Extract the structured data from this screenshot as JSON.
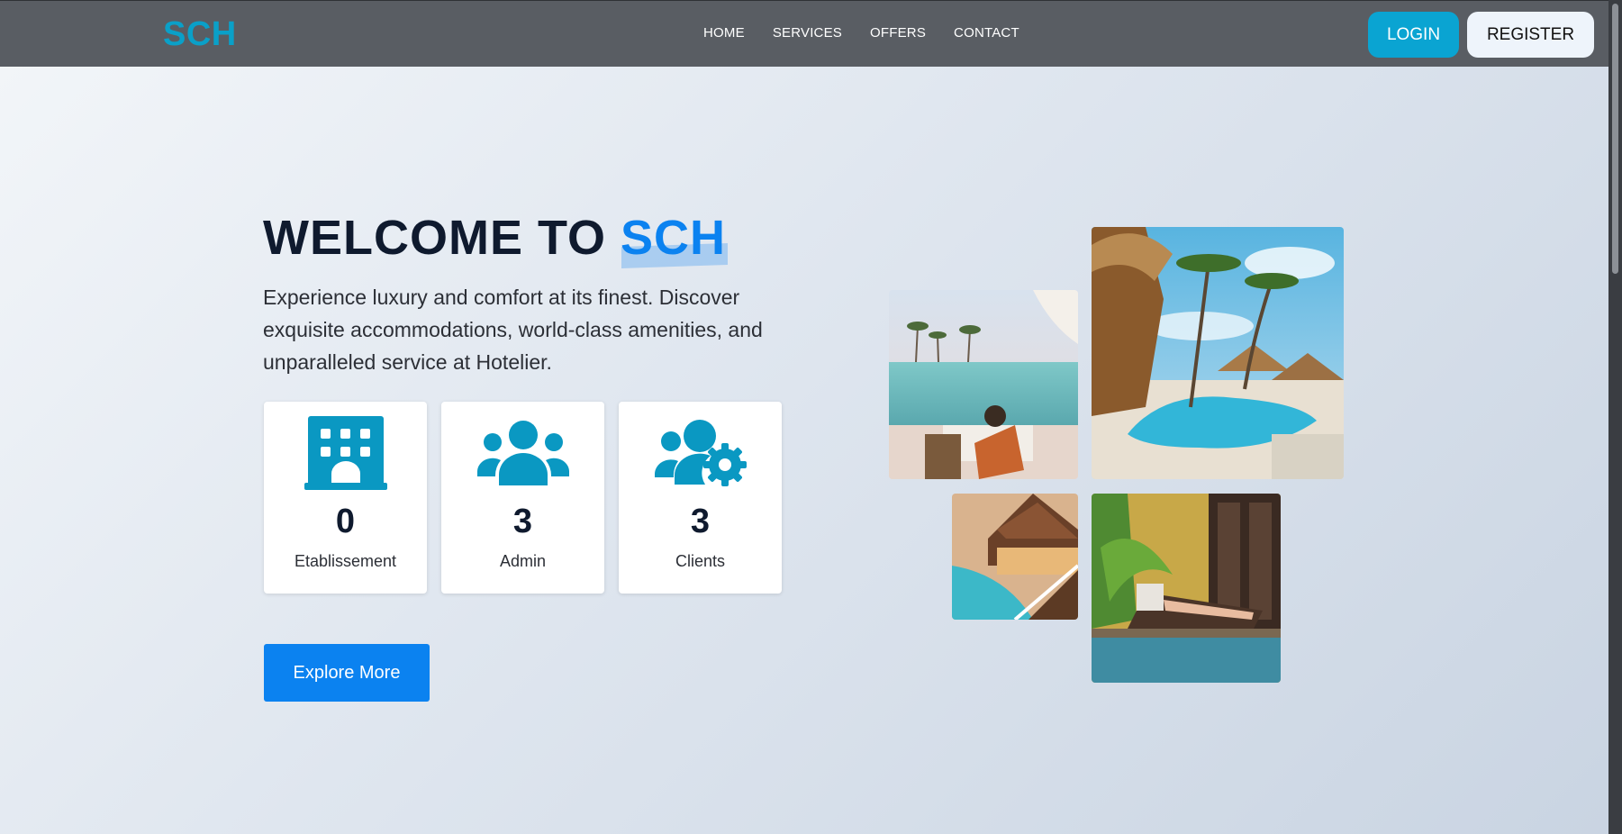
{
  "header": {
    "logo": "SCH",
    "nav": [
      "HOME",
      "SERVICES",
      "OFFERS",
      "CONTACT"
    ],
    "login_label": "LOGIN",
    "register_label": "REGISTER"
  },
  "hero": {
    "title_prefix": "WELCOME TO",
    "title_highlight": "SCH",
    "description": "Experience luxury and comfort at its finest. Discover exquisite accommodations, world-class amenities, and unparalleled service at Hotelier.",
    "stats": [
      {
        "icon": "building-icon",
        "value": "0",
        "label": "Etablissement"
      },
      {
        "icon": "users-icon",
        "value": "3",
        "label": "Admin"
      },
      {
        "icon": "users-gear-icon",
        "value": "3",
        "label": "Clients"
      }
    ],
    "explore_label": "Explore More"
  },
  "gallery": {
    "images": [
      "beach-pool-lounger-photo",
      "tropical-resort-pool-photo",
      "resort-pool-deck-photo",
      "poolside-sunbather-photo"
    ]
  },
  "colors": {
    "navbar": "#595d63",
    "brand": "#0aa0c8",
    "accent": "#0b82f0",
    "login_button": "#0aa4d2"
  }
}
